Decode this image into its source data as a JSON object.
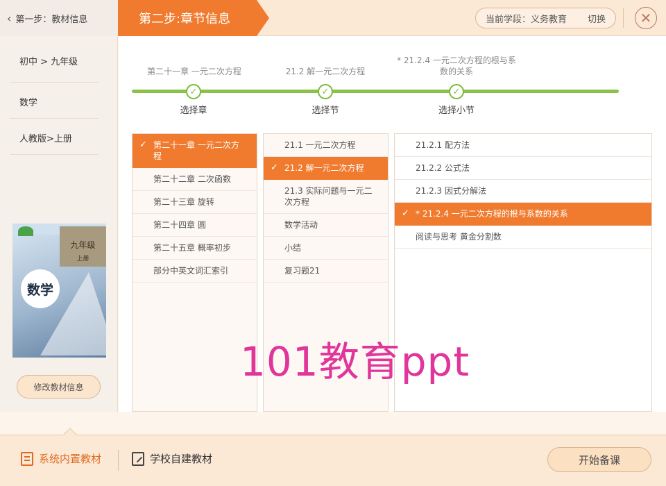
{
  "header": {
    "back_step_label": "第一步：教材信息",
    "current_step_label": "第二步:章节信息",
    "stage_label": "当前学段：义务教育",
    "switch_label": "切换",
    "close_glyph": "✕"
  },
  "sidebar": {
    "grade": "初中 > 九年级",
    "subject": "数学",
    "edition": "人教版>上册",
    "cover": {
      "grade_text": "九年级",
      "volume_text": "上册",
      "subject_text": "数学"
    },
    "modify_button": "修改教材信息"
  },
  "progress": {
    "chapter_value": "第二十一章 一元二次方程",
    "section_value": "21.2 解一元二次方程",
    "subsection_value_line1": "* 21.2.4 一元二次方程的根与系",
    "subsection_value_line2": "数的关系",
    "step_chapter": "选择章",
    "step_section": "选择节",
    "step_subsection": "选择小节",
    "check_glyph": "✓"
  },
  "chapters": [
    {
      "label_line1": "第二十一章 一元二次方",
      "label_line2": "程",
      "selected": true
    },
    {
      "label_line1": "第二十二章 二次函数",
      "selected": false
    },
    {
      "label_line1": "第二十三章 旋转",
      "selected": false
    },
    {
      "label_line1": "第二十四章 圆",
      "selected": false
    },
    {
      "label_line1": "第二十五章 概率初步",
      "selected": false
    },
    {
      "label_line1": "部分中英文词汇索引",
      "selected": false
    }
  ],
  "sections": [
    {
      "label_line1": "21.1 一元二次方程",
      "selected": false
    },
    {
      "label_line1": "21.2 解一元二次方程",
      "selected": true
    },
    {
      "label_line1": "21.3 实际问题与一元二",
      "label_line2": "次方程",
      "selected": false
    },
    {
      "label_line1": "数学活动",
      "selected": false
    },
    {
      "label_line1": "小结",
      "selected": false
    },
    {
      "label_line1": "复习题21",
      "selected": false
    }
  ],
  "subsections": [
    {
      "label_line1": "21.2.1 配方法",
      "selected": false
    },
    {
      "label_line1": "21.2.2 公式法",
      "selected": false
    },
    {
      "label_line1": "21.2.3 因式分解法",
      "selected": false
    },
    {
      "label_line1": "* 21.2.4 一元二次方程的根与系数的关系",
      "selected": true
    },
    {
      "label_line1": "阅读与思考 黄金分割数",
      "selected": false
    }
  ],
  "watermark": "101教育ppt",
  "footer": {
    "tab_builtin": "系统内置教材",
    "tab_school": "学校自建教材",
    "start_button": "开始备课"
  },
  "colors": {
    "accent_orange": "#f07b2f",
    "progress_green": "#8bc34a",
    "watermark_pink": "#e0359a"
  }
}
